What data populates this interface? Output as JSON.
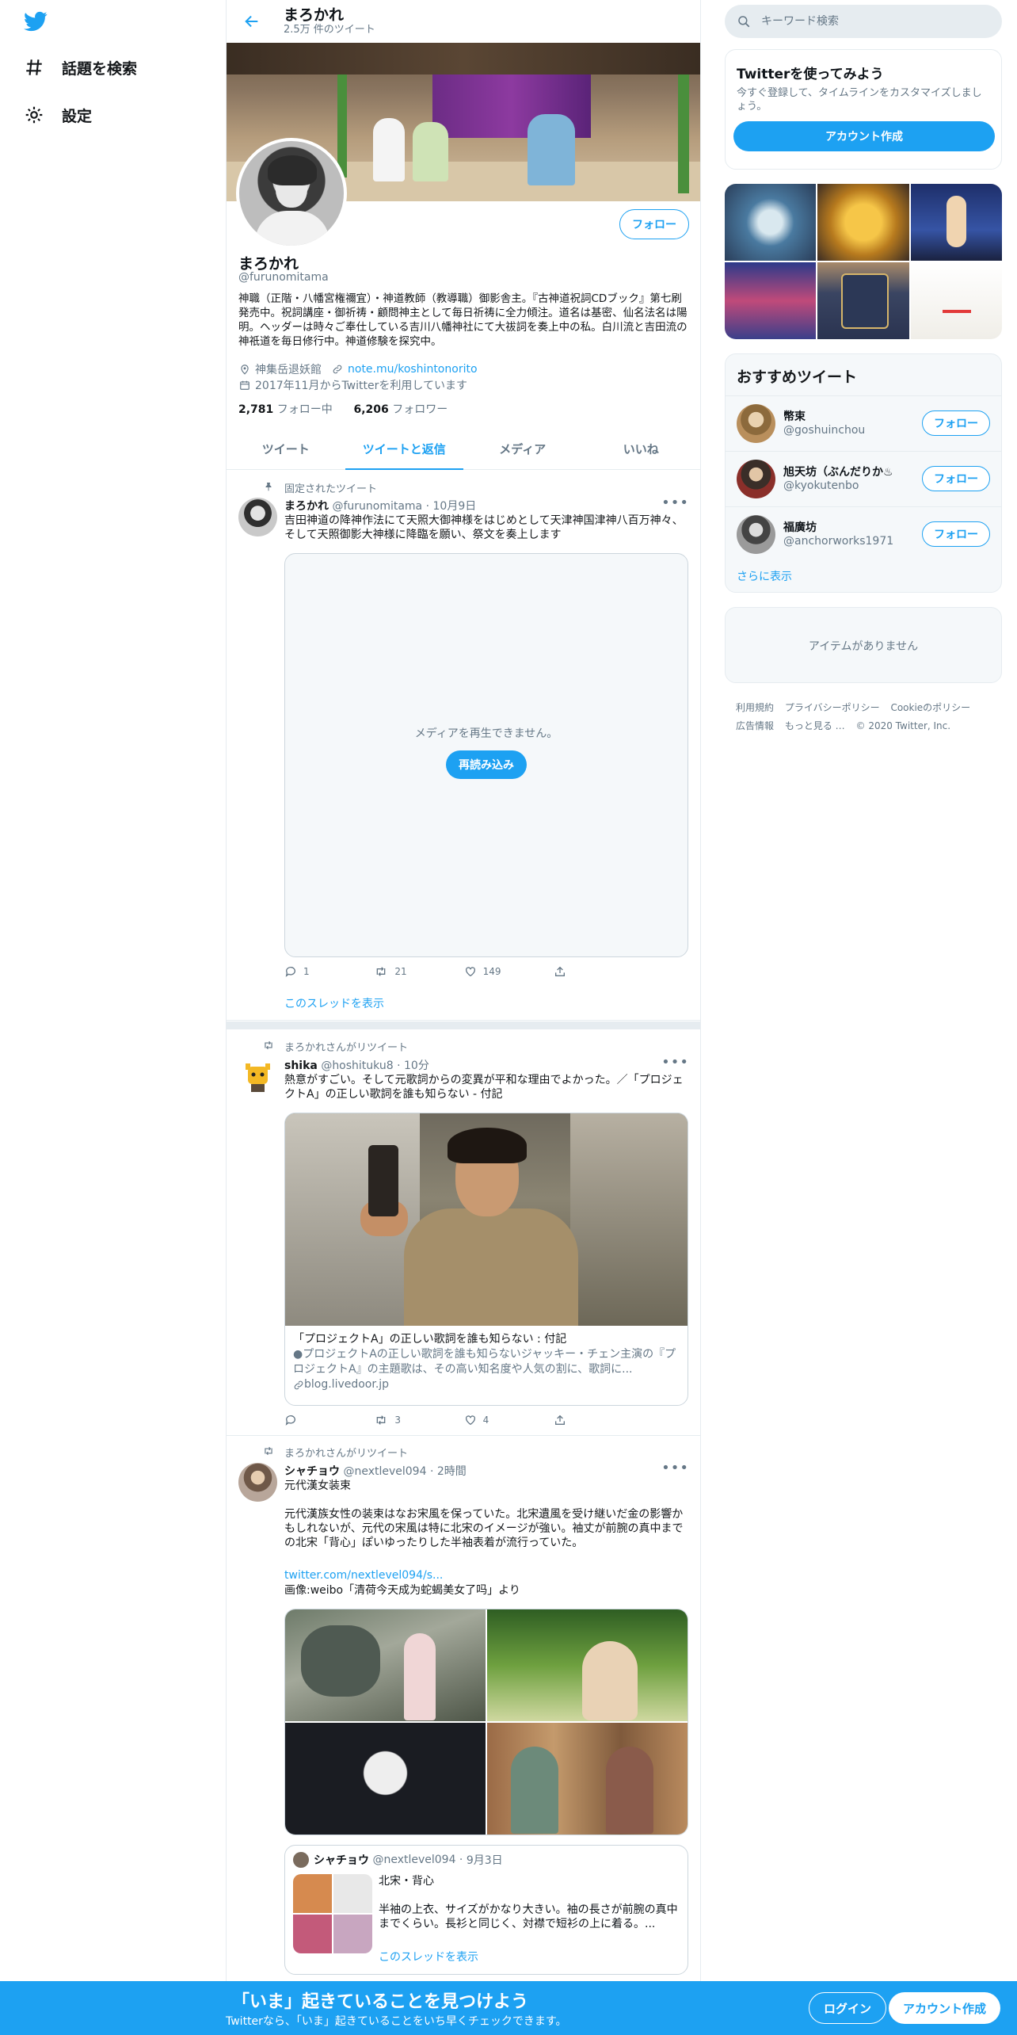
{
  "nav": {
    "logo": "twitter-bird-icon",
    "items": [
      {
        "label": "話題を検索",
        "icon": "hashtag-icon"
      },
      {
        "label": "設定",
        "icon": "gear-icon"
      }
    ]
  },
  "header": {
    "name": "まろかれ",
    "tweet_count": "2.5万 件のツイート"
  },
  "profile": {
    "name": "まろかれ",
    "handle": "@furunomitama",
    "follow_label": "フォロー",
    "bio": "神職（正階・八幡宮権禰宜）・神道教師（教導職）御影舎主。『古神道祝詞CDブック』第七刷発売中。祝詞講座・御祈祷・顧問神主として毎日祈祷に全力傾注。道名は基密、仙名法名は陽明。ヘッダーは時々ご奉仕している吉川八幡神社にて大祓詞を奏上中の私。白川流と吉田流の神祇道を毎日修行中。神道修験を探究中。",
    "location": "神集岳退妖館",
    "website": "note.mu/koshintonorito",
    "joined": "2017年11月からTwitterを利用しています",
    "following_count": "2,781",
    "following_label": "フォロー中",
    "followers_count": "6,206",
    "followers_label": "フォロワー"
  },
  "tabs": [
    {
      "label": "ツイート",
      "active": false
    },
    {
      "label": "ツイートと返信",
      "active": true
    },
    {
      "label": "メディア",
      "active": false
    },
    {
      "label": "いいね",
      "active": false
    }
  ],
  "tweets": [
    {
      "context": "固定されたツイート",
      "name": "まろかれ",
      "handle": "@furunomitama",
      "time": "10月9日",
      "text": "吉田神道の降神作法にて天照大御神様をはじめとして天津神国津神八百万神々、そして天照御影大神様に降臨を願い、祭文を奏上します",
      "media_error": "メディアを再生できません。",
      "reload_label": "再読み込み",
      "replies": "1",
      "retweets": "21",
      "likes": "149",
      "thread_link": "このスレッドを表示"
    },
    {
      "context": "まろかれさんがリツイート",
      "name": "shika",
      "handle": "@hoshituku8",
      "time": "10分",
      "text": "熱意がすごい。そして元歌詞からの変異が平和な理由でよかった。／「プロジェクトA」の正しい歌詞を誰も知らない - 付記",
      "card_title": "「プロジェクトA」の正しい歌詞を誰も知らない : 付記",
      "card_desc": "●プロジェクトAの正しい歌詞を誰も知らないジャッキー・チェン主演の『プロジェクトA』の主題歌は、その高い知名度や人気の割に、歌詞に...",
      "card_domain": "blog.livedoor.jp",
      "replies": "",
      "retweets": "3",
      "likes": "4"
    },
    {
      "context": "まろかれさんがリツイート",
      "name": "シャチョウ",
      "handle": "@nextlevel094",
      "time": "2時間",
      "text": "元代漢女装束",
      "text2": "元代漢族女性の装束はなお宋風を保っていた。北宋遺風を受け継いだ金の影響かもしれないが、元代の宋風は特に北宋のイメージが強い。袖丈が前腕の真中までの北宋「背心」ぽいゆったりした半袖表着が流行っていた。",
      "link": "twitter.com/nextlevel094/s...",
      "text3": "画像:weibo「清荷今天成为蛇蝎美女了吗」より",
      "quote": {
        "name": "シャチョウ",
        "handle": "@nextlevel094",
        "time": "9月3日",
        "title": "北宋・背心",
        "text": "半袖の上衣、サイズがかなり大きい。袖の長さが前腕の真中までくらい。長衫と同じく、対襟で短衫の上に着る。...",
        "thread_link": "このスレッドを表示"
      }
    }
  ],
  "sidebar": {
    "search_placeholder": "キーワード検索",
    "signup_title": "Twitterを使ってみよう",
    "signup_sub": "今すぐ登録して、タイムラインをカスタマイズしましょう。",
    "signup_button": "アカウント作成",
    "reco_title": "おすすめツイート",
    "reco": [
      {
        "name": "幣束",
        "handle": "@goshuinchou",
        "follow": "フォロー"
      },
      {
        "name": "旭天坊（ぶんだりか♨",
        "handle": "@kyokutenbo",
        "follow": "フォロー"
      },
      {
        "name": "福廣坊",
        "handle": "@anchorworks1971",
        "follow": "フォロー"
      }
    ],
    "reco_more": "さらに表示",
    "empty": "アイテムがありません",
    "footer": [
      "利用規約",
      "プライバシーポリシー",
      "Cookieのポリシー",
      "広告情報",
      "もっと見る …",
      "© 2020 Twitter, Inc."
    ]
  },
  "bottom": {
    "title": "「いま」起きていることを見つけよう",
    "sub": "Twitterなら、「いま」起きていることをいち早くチェックできます。",
    "login": "ログイン",
    "signup": "アカウント作成"
  },
  "colors": {
    "accent": "#1da1f2",
    "text_secondary": "#657786",
    "border": "#e6ecf0"
  }
}
